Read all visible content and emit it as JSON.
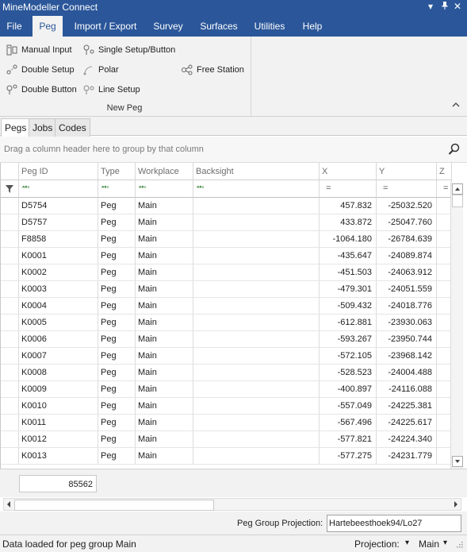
{
  "window": {
    "title": "MineModeller Connect",
    "controls": [
      "▾",
      "ᵖ",
      "✕"
    ]
  },
  "menu": [
    {
      "label": "File",
      "active": false
    },
    {
      "label": "Peg",
      "active": true
    },
    {
      "label": "Import / Export",
      "active": false
    },
    {
      "label": "Survey",
      "active": false
    },
    {
      "label": "Surfaces",
      "active": false
    },
    {
      "label": "Utilities",
      "active": false
    },
    {
      "label": "Help",
      "active": false
    }
  ],
  "ribbon": {
    "group_label": "New Peg",
    "buttons": {
      "manual_input": "Manual Input",
      "single_setup": "Single Setup/Button",
      "double_setup": "Double Setup",
      "polar": "Polar",
      "free_station": "Free Station",
      "double_button": "Double Button",
      "line_setup": "Line Setup"
    }
  },
  "tabs": [
    {
      "label": "Pegs",
      "active": true
    },
    {
      "label": "Jobs",
      "active": false
    },
    {
      "label": "Codes",
      "active": false
    }
  ],
  "group_panel_hint": "Drag a column header here to group by that column",
  "columns": [
    "Peg ID",
    "Type",
    "Workplace",
    "Backsight",
    "X",
    "Y",
    "Z"
  ],
  "rows": [
    {
      "id": "D5754",
      "type": "Peg",
      "workplace": "Main",
      "backsight": "",
      "x": "457.832",
      "y": "-25032.520"
    },
    {
      "id": "D5757",
      "type": "Peg",
      "workplace": "Main",
      "backsight": "",
      "x": "433.872",
      "y": "-25047.760"
    },
    {
      "id": "F8858",
      "type": "Peg",
      "workplace": "Main",
      "backsight": "",
      "x": "-1064.180",
      "y": "-26784.639"
    },
    {
      "id": "K0001",
      "type": "Peg",
      "workplace": "Main",
      "backsight": "",
      "x": "-435.647",
      "y": "-24089.874"
    },
    {
      "id": "K0002",
      "type": "Peg",
      "workplace": "Main",
      "backsight": "",
      "x": "-451.503",
      "y": "-24063.912"
    },
    {
      "id": "K0003",
      "type": "Peg",
      "workplace": "Main",
      "backsight": "",
      "x": "-479.301",
      "y": "-24051.559"
    },
    {
      "id": "K0004",
      "type": "Peg",
      "workplace": "Main",
      "backsight": "",
      "x": "-509.432",
      "y": "-24018.776"
    },
    {
      "id": "K0005",
      "type": "Peg",
      "workplace": "Main",
      "backsight": "",
      "x": "-612.881",
      "y": "-23930.063"
    },
    {
      "id": "K0006",
      "type": "Peg",
      "workplace": "Main",
      "backsight": "",
      "x": "-593.267",
      "y": "-23950.744"
    },
    {
      "id": "K0007",
      "type": "Peg",
      "workplace": "Main",
      "backsight": "",
      "x": "-572.105",
      "y": "-23968.142"
    },
    {
      "id": "K0008",
      "type": "Peg",
      "workplace": "Main",
      "backsight": "",
      "x": "-528.523",
      "y": "-24004.488"
    },
    {
      "id": "K0009",
      "type": "Peg",
      "workplace": "Main",
      "backsight": "",
      "x": "-400.897",
      "y": "-24116.088"
    },
    {
      "id": "K0010",
      "type": "Peg",
      "workplace": "Main",
      "backsight": "",
      "x": "-557.049",
      "y": "-24225.381"
    },
    {
      "id": "K0011",
      "type": "Peg",
      "workplace": "Main",
      "backsight": "",
      "x": "-567.496",
      "y": "-24225.617"
    },
    {
      "id": "K0012",
      "type": "Peg",
      "workplace": "Main",
      "backsight": "",
      "x": "-577.821",
      "y": "-24224.340"
    },
    {
      "id": "K0013",
      "type": "Peg",
      "workplace": "Main",
      "backsight": "",
      "x": "-577.275",
      "y": "-24231.779"
    }
  ],
  "footer": {
    "row_count": "85562"
  },
  "projection": {
    "label": "Peg Group Projection:",
    "value": "Hartebeesthoek94/Lo27"
  },
  "status": {
    "message": "Data loaded for peg group Main",
    "projection_label": "Projection:",
    "workplace_value": "Main"
  },
  "colors": {
    "title_bar": "#2b579a",
    "ribbon_bg": "#f2f2f2"
  }
}
